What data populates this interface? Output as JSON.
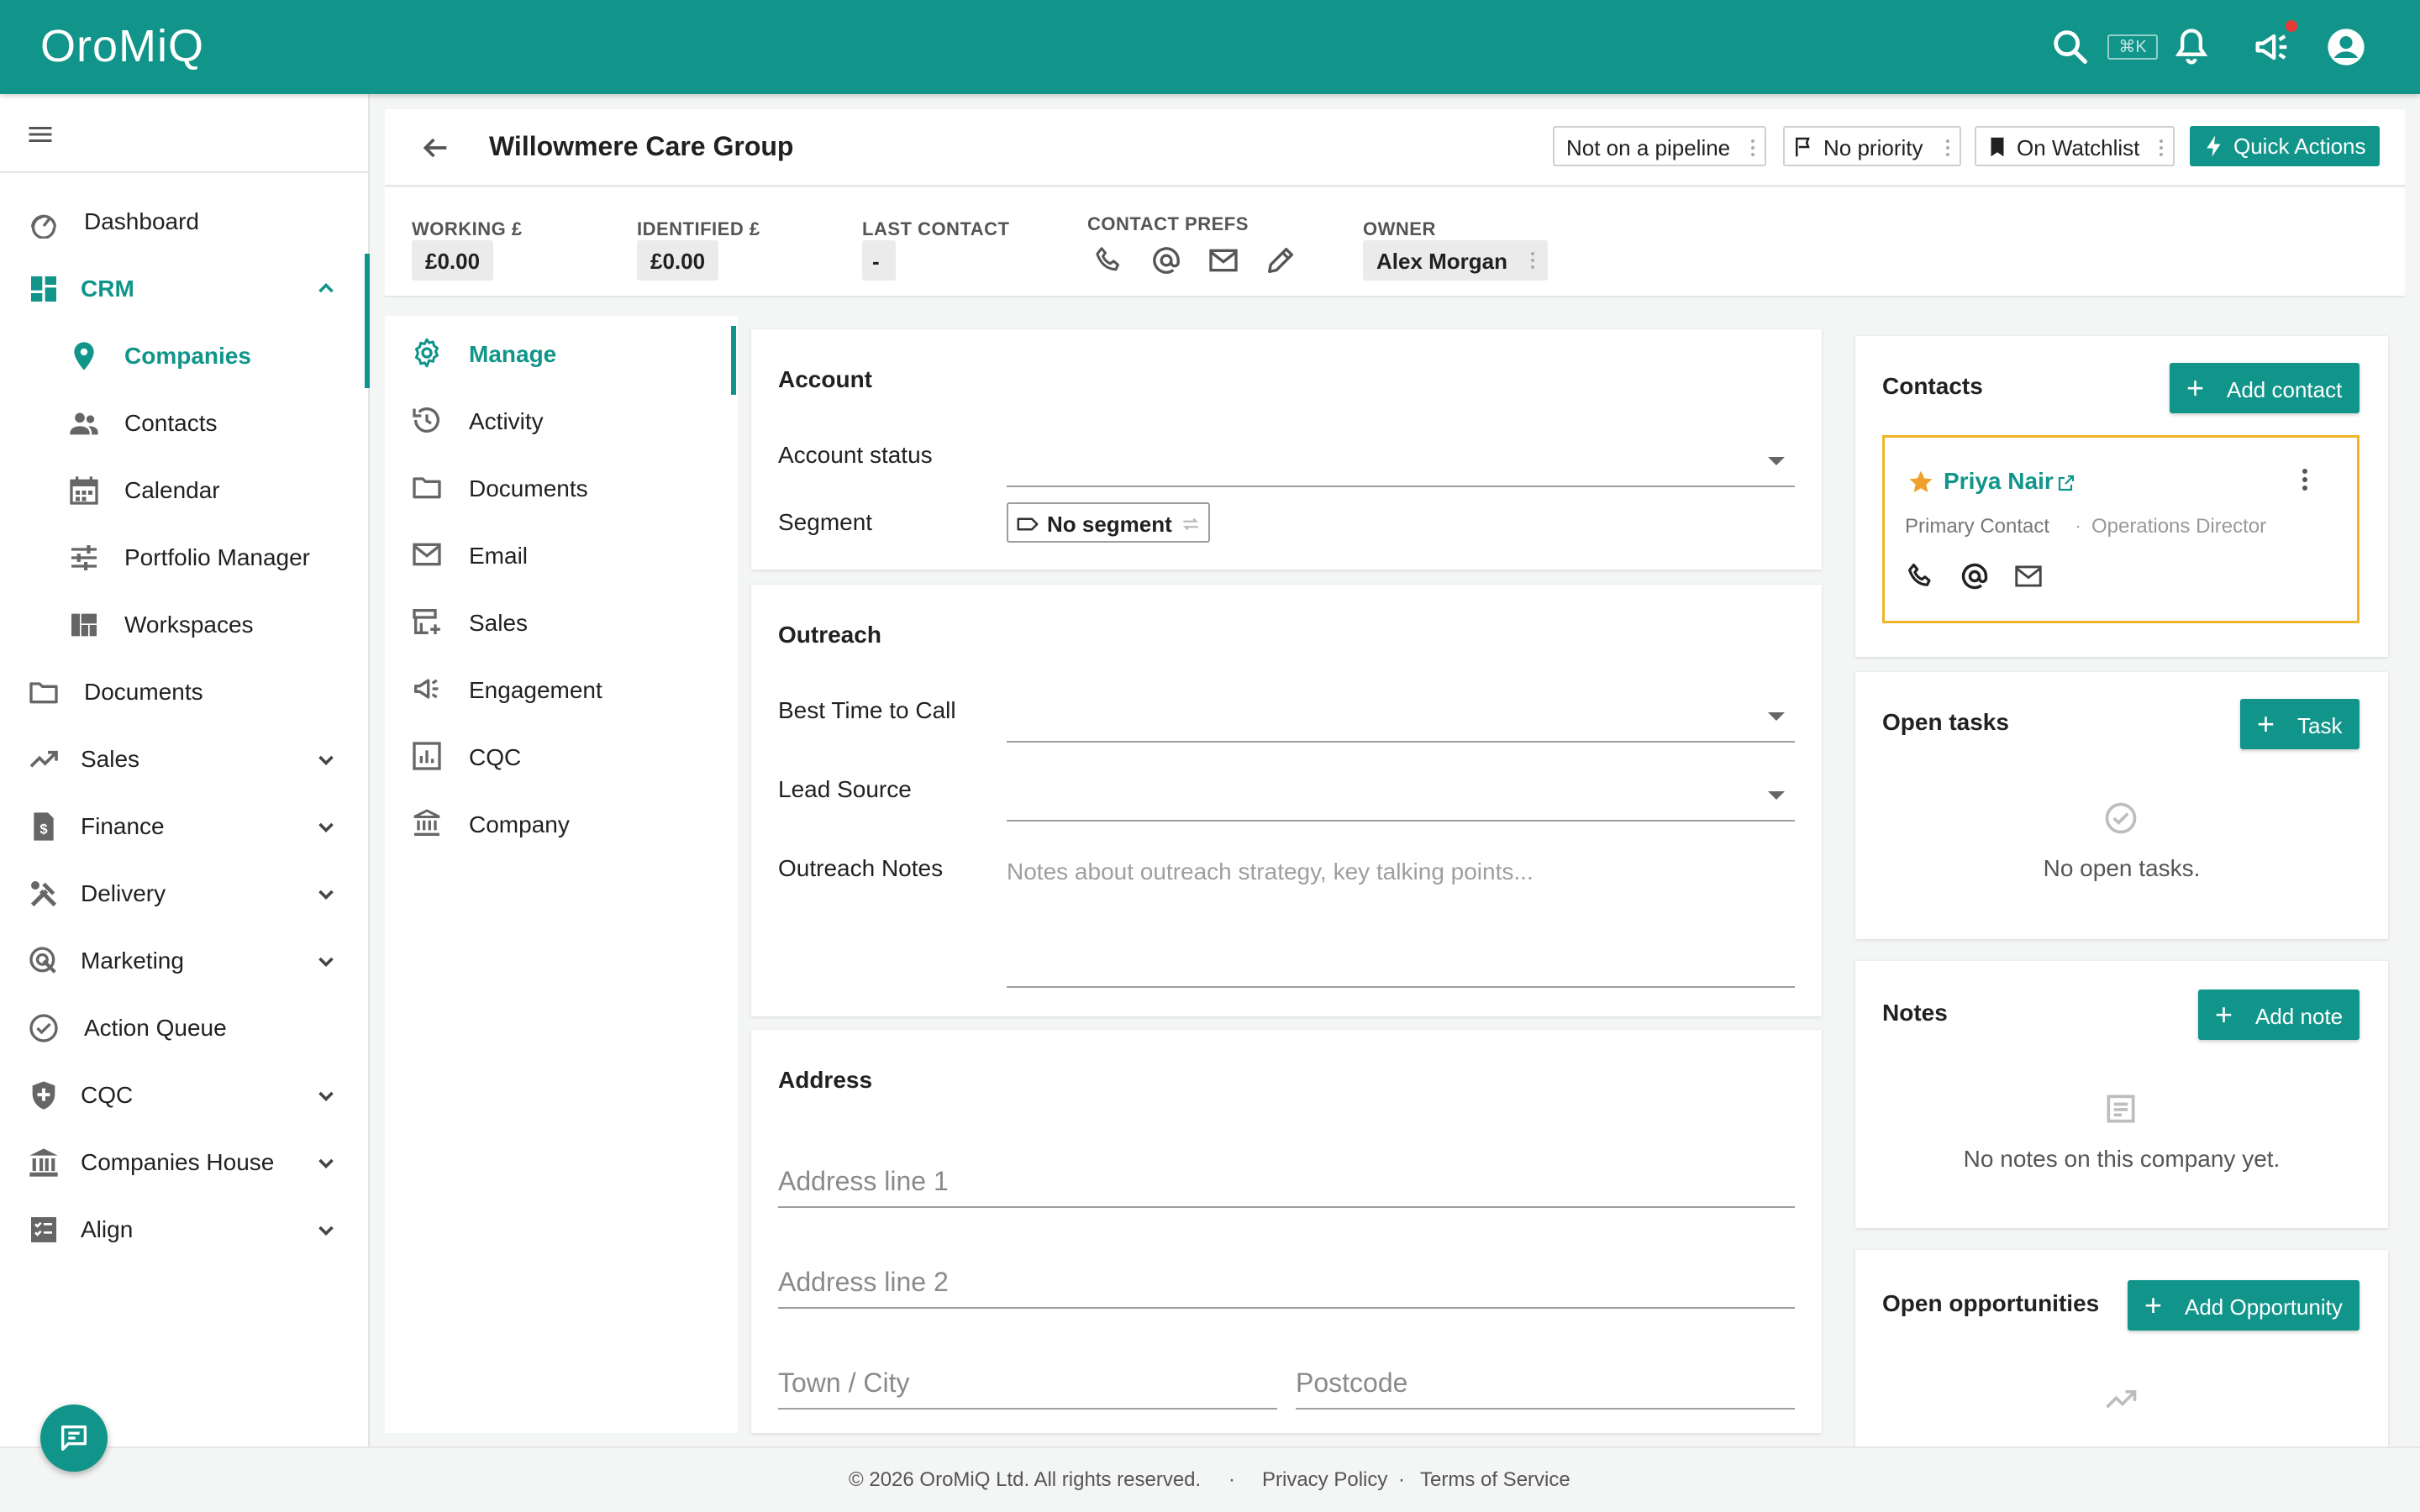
{
  "app": {
    "logo": "OroMiQ",
    "shortcut": "⌘K"
  },
  "topbar": {
    "icons": [
      "search-icon",
      "bell-icon",
      "megaphone-icon",
      "account-icon"
    ],
    "accent": "#11958a"
  },
  "sidebar": {
    "items": [
      {
        "label": "Dashboard",
        "icon": "dashboard-icon"
      },
      {
        "label": "CRM",
        "icon": "crm-grid-icon",
        "active": true
      },
      {
        "label": "Companies",
        "icon": "location-pin-icon",
        "active": true
      },
      {
        "label": "Contacts",
        "icon": "people-icon"
      },
      {
        "label": "Calendar",
        "icon": "calendar-icon"
      },
      {
        "label": "Portfolio Manager",
        "icon": "sliders-icon"
      },
      {
        "label": "Workspaces",
        "icon": "workspaces-icon"
      },
      {
        "label": "Documents",
        "icon": "folder-icon"
      },
      {
        "label": "Sales",
        "icon": "trending-up-icon"
      },
      {
        "label": "Finance",
        "icon": "finance-doc-icon"
      },
      {
        "label": "Delivery",
        "icon": "tools-icon"
      },
      {
        "label": "Marketing",
        "icon": "marketing-icon"
      },
      {
        "label": "Action Queue",
        "icon": "check-circle-icon"
      },
      {
        "label": "CQC",
        "icon": "shield-icon"
      },
      {
        "label": "Companies House",
        "icon": "bank-icon"
      },
      {
        "label": "Align",
        "icon": "align-icon"
      }
    ]
  },
  "header": {
    "title": "Willowmere Care Group",
    "pipeline": "Not on a pipeline",
    "priority": "No priority",
    "watchlist": "On Watchlist",
    "quick_actions": "Quick Actions"
  },
  "stats": {
    "working_label": "WORKING £",
    "working_value": "£0.00",
    "identified_label": "IDENTIFIED £",
    "identified_value": "£0.00",
    "last_contact_label": "LAST CONTACT",
    "last_contact_value": "-",
    "prefs_label": "CONTACT PREFS",
    "owner_label": "OWNER",
    "owner_value": "Alex Morgan"
  },
  "sections": {
    "items": [
      {
        "label": "Manage",
        "icon": "gear-icon",
        "active": true
      },
      {
        "label": "Activity",
        "icon": "history-icon"
      },
      {
        "label": "Documents",
        "icon": "folder-icon"
      },
      {
        "label": "Email",
        "icon": "mail-icon"
      },
      {
        "label": "Sales",
        "icon": "store-icon"
      },
      {
        "label": "Engagement",
        "icon": "megaphone-icon"
      },
      {
        "label": "CQC",
        "icon": "chart-box-icon"
      },
      {
        "label": "Company",
        "icon": "bank-icon"
      }
    ]
  },
  "account": {
    "title": "Account",
    "status_label": "Account status",
    "segment_label": "Segment",
    "segment_value": "No segment"
  },
  "outreach": {
    "title": "Outreach",
    "best_time_label": "Best Time to Call",
    "lead_source_label": "Lead Source",
    "notes_label": "Outreach Notes",
    "notes_placeholder": "Notes about outreach strategy, key talking points..."
  },
  "address": {
    "title": "Address",
    "line1_placeholder": "Address line 1",
    "line2_placeholder": "Address line 2",
    "town_placeholder": "Town / City",
    "postcode_placeholder": "Postcode"
  },
  "contacts": {
    "title": "Contacts",
    "add_label": "Add contact",
    "primary": {
      "name": "Priya Nair",
      "role": "Primary Contact",
      "job": "Operations Director",
      "separator": "·"
    }
  },
  "tasks": {
    "title": "Open tasks",
    "add_label": "Task",
    "empty": "No open tasks."
  },
  "notes": {
    "title": "Notes",
    "add_label": "Add note",
    "empty": "No notes on this company yet."
  },
  "opportunities": {
    "title": "Open opportunities",
    "add_label": "Add Opportunity"
  },
  "footer": {
    "copyright": "© 2026 OroMiQ Ltd. All rights reserved.",
    "sep": "·",
    "privacy": "Privacy Policy",
    "terms": "Terms of Service"
  }
}
